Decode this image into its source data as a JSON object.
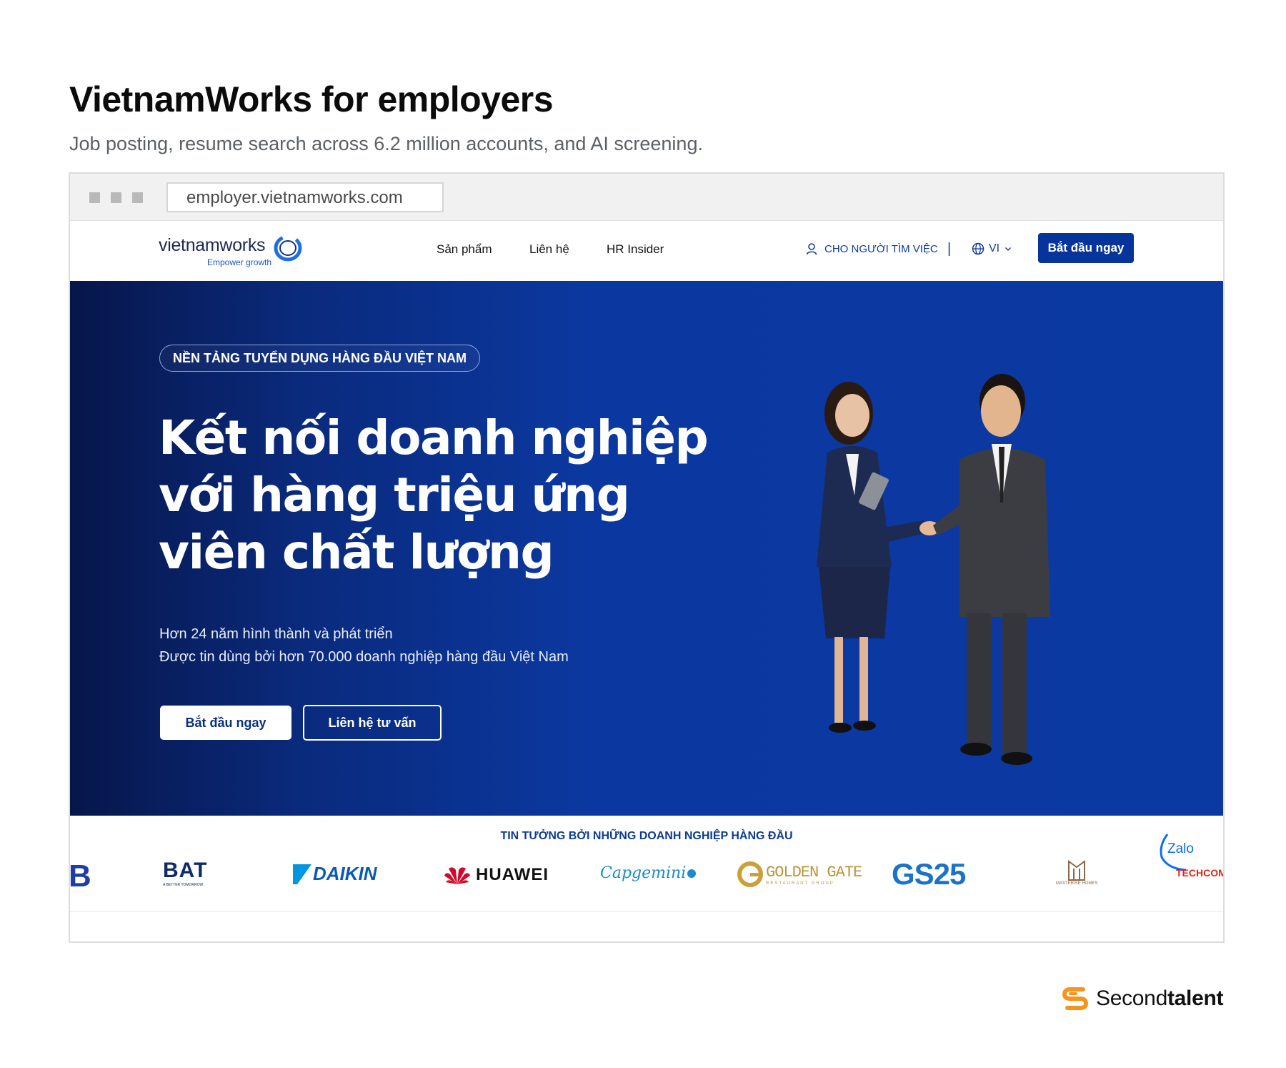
{
  "header": {
    "title": "VietnamWorks for employers",
    "subtitle": "Job posting, resume search across 6.2 million accounts, and AI screening."
  },
  "browser": {
    "url": "employer.vietnamworks.com"
  },
  "nav": {
    "logo_word": "vietnamworks",
    "logo_tagline": "Empower growth",
    "links": [
      "Sản phẩm",
      "Liên hệ",
      "HR Insider"
    ],
    "seeker_link": "CHO NGƯỜI TÌM VIỆC",
    "separator": "|",
    "language": "VI",
    "cta": "Bắt đầu ngay"
  },
  "hero": {
    "badge": "NỀN TẢNG TUYỂN DỤNG HÀNG ĐẦU VIỆT NAM",
    "heading_lines": [
      "Kết nối doanh nghiệp",
      "với hàng triệu ứng",
      "viên chất lượng"
    ],
    "description_lines": [
      "Hơn 24 năm hình thành và phát triển",
      "Được tin dùng bởi hơn 70.000 doanh nghiệp hàng đầu Việt Nam"
    ],
    "primary_button": "Bắt đầu ngay",
    "secondary_button": "Liên hệ tư vấn",
    "background_color": "#0b39a2"
  },
  "trust": {
    "title": "TIN TƯỞNG BỞI NHỮNG DOANH NGHIỆP HÀNG ĐẦU",
    "logos": {
      "partial_left": "B",
      "bat": "BAT",
      "bat_tagline": "A BETTER TOMORROW",
      "daikin": "DAIKIN",
      "huawei": "HUAWEI",
      "capgemini": "Capgemini",
      "golden_gate": "GOLDEN GATE",
      "golden_gate_sub": "RESTAURANT GROUP",
      "gs25": "GS25",
      "masterise": "MASTERISE HOMES",
      "zalo": "Zalo",
      "techcom": "TECHCOM"
    }
  },
  "branding": {
    "name_regular": "Second",
    "name_bold": "talent",
    "accent_color": "#f7941d"
  }
}
